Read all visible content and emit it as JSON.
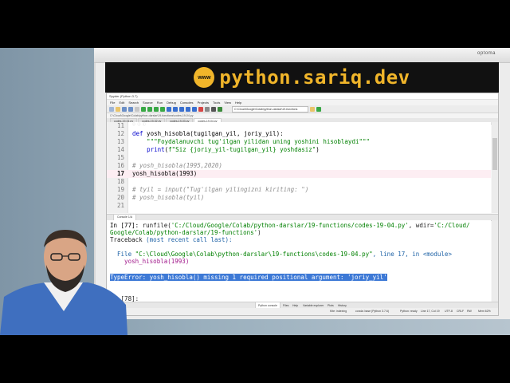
{
  "banner": {
    "title": "python.sariq.dev",
    "logo_text": "www"
  },
  "projector_brand": "optoma",
  "window": {
    "title": "Spyder (Python 3.7)",
    "menu": [
      "File",
      "Edit",
      "Search",
      "Source",
      "Run",
      "Debug",
      "Consoles",
      "Projects",
      "Tools",
      "View",
      "Help"
    ],
    "path_box": "C:\\Cloud\\Google\\Colab\\python-darslar\\19-functions",
    "file_path": "C:\\Cloud\\Google\\Colab\\python-darslar\\19-functions\\codes-19-04.py"
  },
  "editor_tabs": [
    "codes-19-01.py",
    "codes-19-02.py",
    "codes-19-03.py",
    "codes-19-04.py"
  ],
  "editor": {
    "lines": [
      {
        "num": "11",
        "text": ""
      },
      {
        "num": "12",
        "text": "def yosh_hisobla(tugilgan_yil, joriy_yil):"
      },
      {
        "num": "13",
        "text": "    \"\"\"Foydalanuvchi tug'ilgan yilidan uning yoshini hisoblaydi\"\"\""
      },
      {
        "num": "14",
        "text": "    print(f\"Siz {joriy_yil-tugilgan_yil} yoshdasiz\")"
      },
      {
        "num": "15",
        "text": ""
      },
      {
        "num": "16",
        "text": "# yosh_hisobla(1995,2020)"
      },
      {
        "num": "17",
        "text": "yosh_hisobla(1993)"
      },
      {
        "num": "18",
        "text": ""
      },
      {
        "num": "19",
        "text": "# tyil = input(\"Tug'ilgan yilingizni kiriting: \")"
      },
      {
        "num": "20",
        "text": "# yosh_hisobla(tyil)"
      },
      {
        "num": "21",
        "text": ""
      }
    ]
  },
  "console_tab": "Console 1/A",
  "console": {
    "run_prompt": "In [77]: ",
    "run_cmd": "runfile(",
    "run_path": "'C:/Cloud/Google/Colab/python-darslar/19-functions/codes-19-04.py'",
    "run_wdir_label": ", wdir=",
    "run_wdir": "'C:/Cloud/",
    "run_wdir2": "Google/Colab/python-darslar/19-functions'",
    "run_close": ")",
    "traceback": "Traceback ",
    "traceback_note": "(most recent call last):",
    "file_line_prefix": "  File ",
    "file_line_path": "\"C:\\Cloud\\Google\\Colab\\python-darslar\\19-functions\\codes-19-04.py\"",
    "file_line_suffix": ", line 17, in <module>",
    "call_line": "    yosh_hisobla(1993)",
    "error": "TypeError: yosh_hisobla() missing 1 required positional argument: 'joriy_yil'",
    "next_prompt": "In [78]:"
  },
  "bottom_tabs": [
    "Python console",
    "Files",
    "Help",
    "Variable explorer",
    "Plots",
    "History"
  ],
  "status": {
    "kite": "Kite: indexing",
    "conda": "conda: base (Python 3.7.6)",
    "lsp": "Python: ready",
    "line_col": "Line 17, Col 19",
    "encoding": "UTF-8",
    "eol": "CRLF",
    "perm": "RW",
    "mem": "Mem 62%"
  }
}
